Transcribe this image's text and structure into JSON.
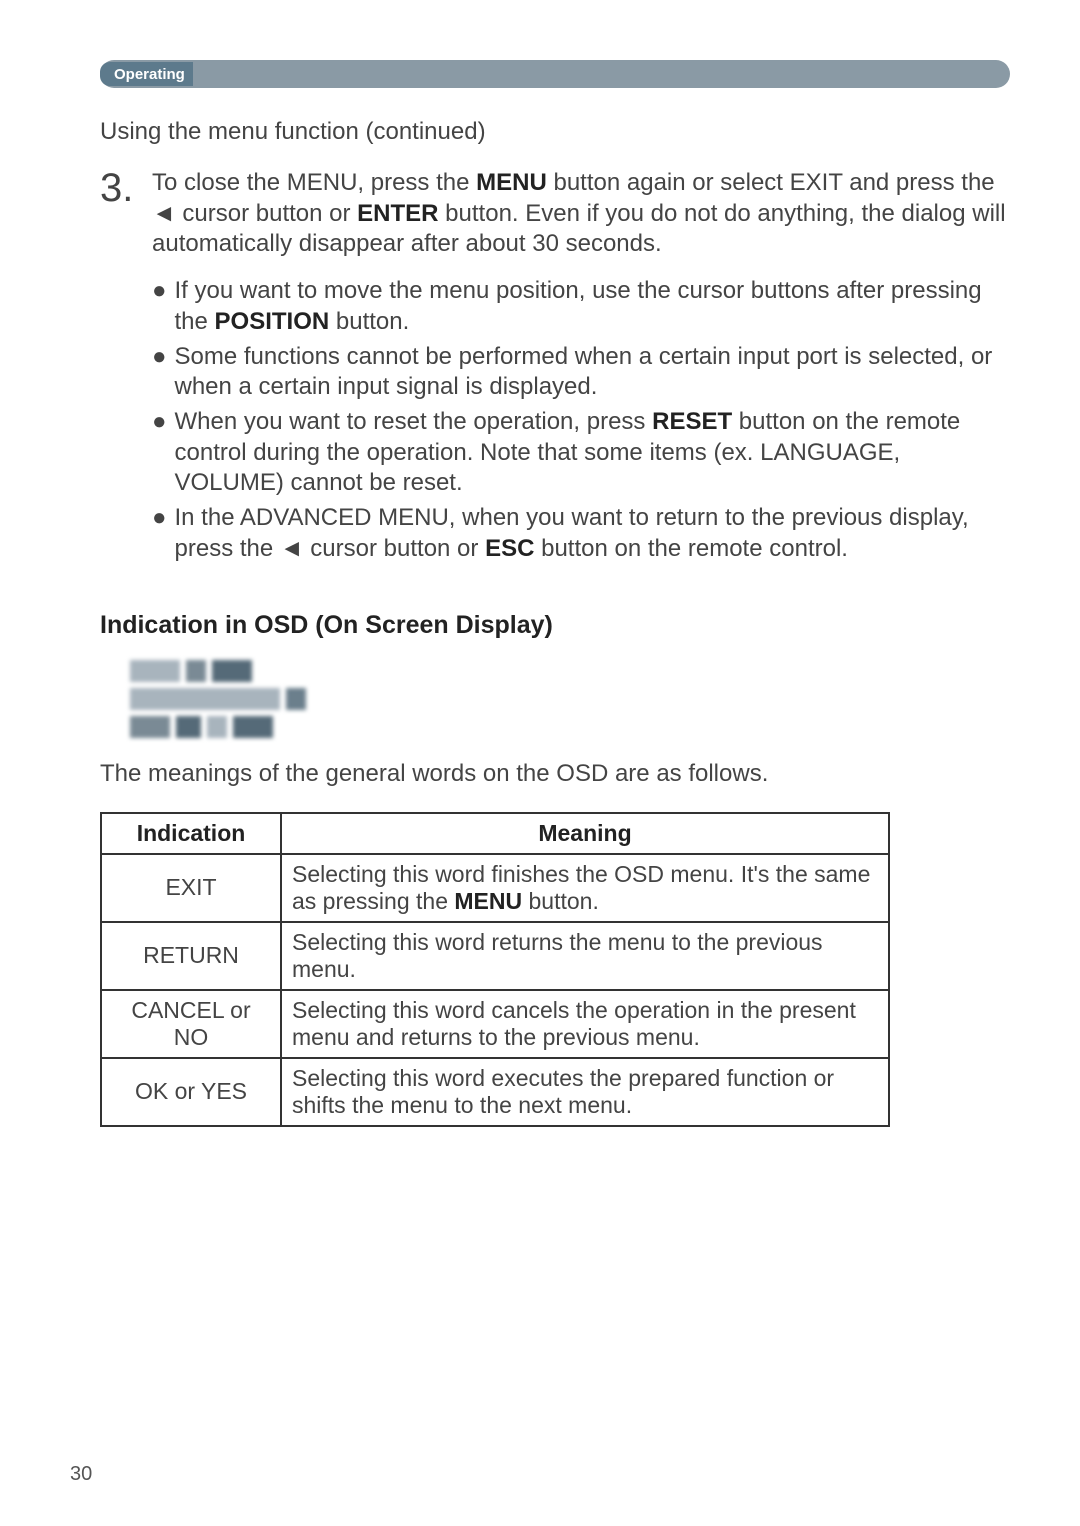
{
  "section_label": "Operating",
  "subtitle": "Using the menu function (continued)",
  "step": {
    "number": "3.",
    "parts": [
      "To close the MENU, press the ",
      {
        "bold": true,
        "text": "MENU"
      },
      " button again or select EXIT and press the ◄ cursor button or ",
      {
        "bold": true,
        "text": "ENTER"
      },
      " button. Even if you do not do anything, the dialog will automatically disappear after about 30 seconds."
    ]
  },
  "bullets": [
    [
      "If you want to move the menu position, use the cursor buttons after pressing the ",
      {
        "bold": true,
        "text": "POSITION"
      },
      " button."
    ],
    [
      "Some functions cannot be performed when a certain input port is selected, or when a certain input signal is displayed."
    ],
    [
      "When you want to reset the operation, press ",
      {
        "bold": true,
        "text": "RESET"
      },
      " button on the remote control during the operation. Note that some items (ex. LANGUAGE, VOLUME) cannot be reset."
    ],
    [
      "In the ADVANCED MENU, when you want to return to the previous display, press the ◄ cursor button or ",
      {
        "bold": true,
        "text": "ESC"
      },
      " button on the remote control."
    ]
  ],
  "osd_heading": "Indication in OSD (On Screen Display)",
  "osd_intro": "The meanings of the general words on the OSD are as follows.",
  "table": {
    "headers": [
      "Indication",
      "Meaning"
    ],
    "rows": [
      {
        "indication": "EXIT",
        "meaning": [
          "Selecting this word finishes the OSD menu. It's the same as pressing the ",
          {
            "bold": true,
            "text": "MENU"
          },
          " button."
        ]
      },
      {
        "indication": "RETURN",
        "meaning": [
          "Selecting this word returns the menu to the previous menu."
        ]
      },
      {
        "indication": "CANCEL or NO",
        "meaning": [
          "Selecting this word cancels the operation in the present menu and returns to the previous menu."
        ]
      },
      {
        "indication": "OK or YES",
        "meaning": [
          "Selecting this word executes the prepared function or shifts the menu to the next menu."
        ]
      }
    ]
  },
  "page_number": "30"
}
